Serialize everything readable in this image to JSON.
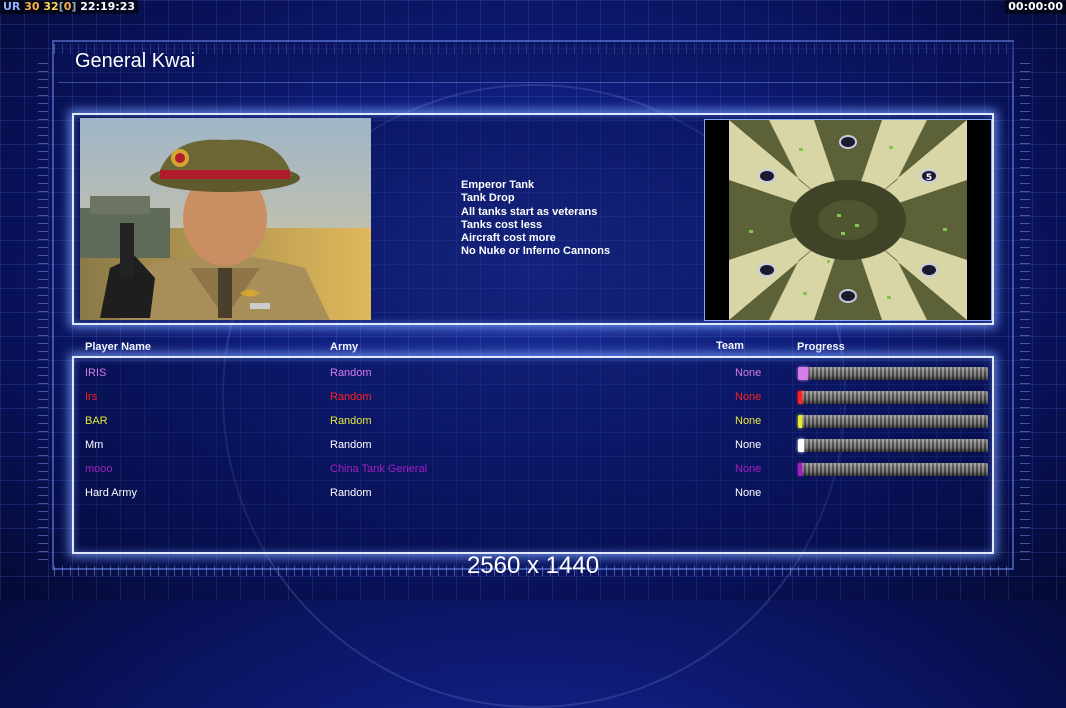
{
  "hud": {
    "left": {
      "ur": "UR",
      "n1": "30",
      "n2": "32",
      "br_open": "[",
      "n3": "0",
      "br_close": "]",
      "time": "22:19:23"
    },
    "right_time": "00:00:00"
  },
  "general": {
    "name": "General Kwai",
    "traits": [
      "Emperor Tank",
      "Tank Drop",
      "All tanks start as veterans",
      "Tanks cost less",
      "Aircraft cost more",
      "No Nuke or Inferno Cannons"
    ]
  },
  "minimap": {
    "start_label": "5"
  },
  "columns": {
    "player": "Player Name",
    "army": "Army",
    "team": "Team",
    "progress": "Progress"
  },
  "players": [
    {
      "name": "IRIS",
      "army": "Random",
      "team": "None",
      "color": "#d67ce8",
      "progress": 0.05
    },
    {
      "name": "Irs",
      "army": "Random",
      "team": "None",
      "color": "#ff2020",
      "progress": 0.02
    },
    {
      "name": "BAR",
      "army": "Random",
      "team": "None",
      "color": "#e8e83a",
      "progress": 0.01
    },
    {
      "name": "Mm",
      "army": "Random",
      "team": "None",
      "color": "#ffffff",
      "progress": 0.03
    },
    {
      "name": "mooo",
      "army": "China Tank General",
      "team": "None",
      "color": "#a020c0",
      "progress": 0.02
    },
    {
      "name": "Hard Army",
      "army": "Random",
      "team": "None",
      "color": "#ffffff",
      "progress": null
    }
  ],
  "resolution_label": "2560 x 1440"
}
